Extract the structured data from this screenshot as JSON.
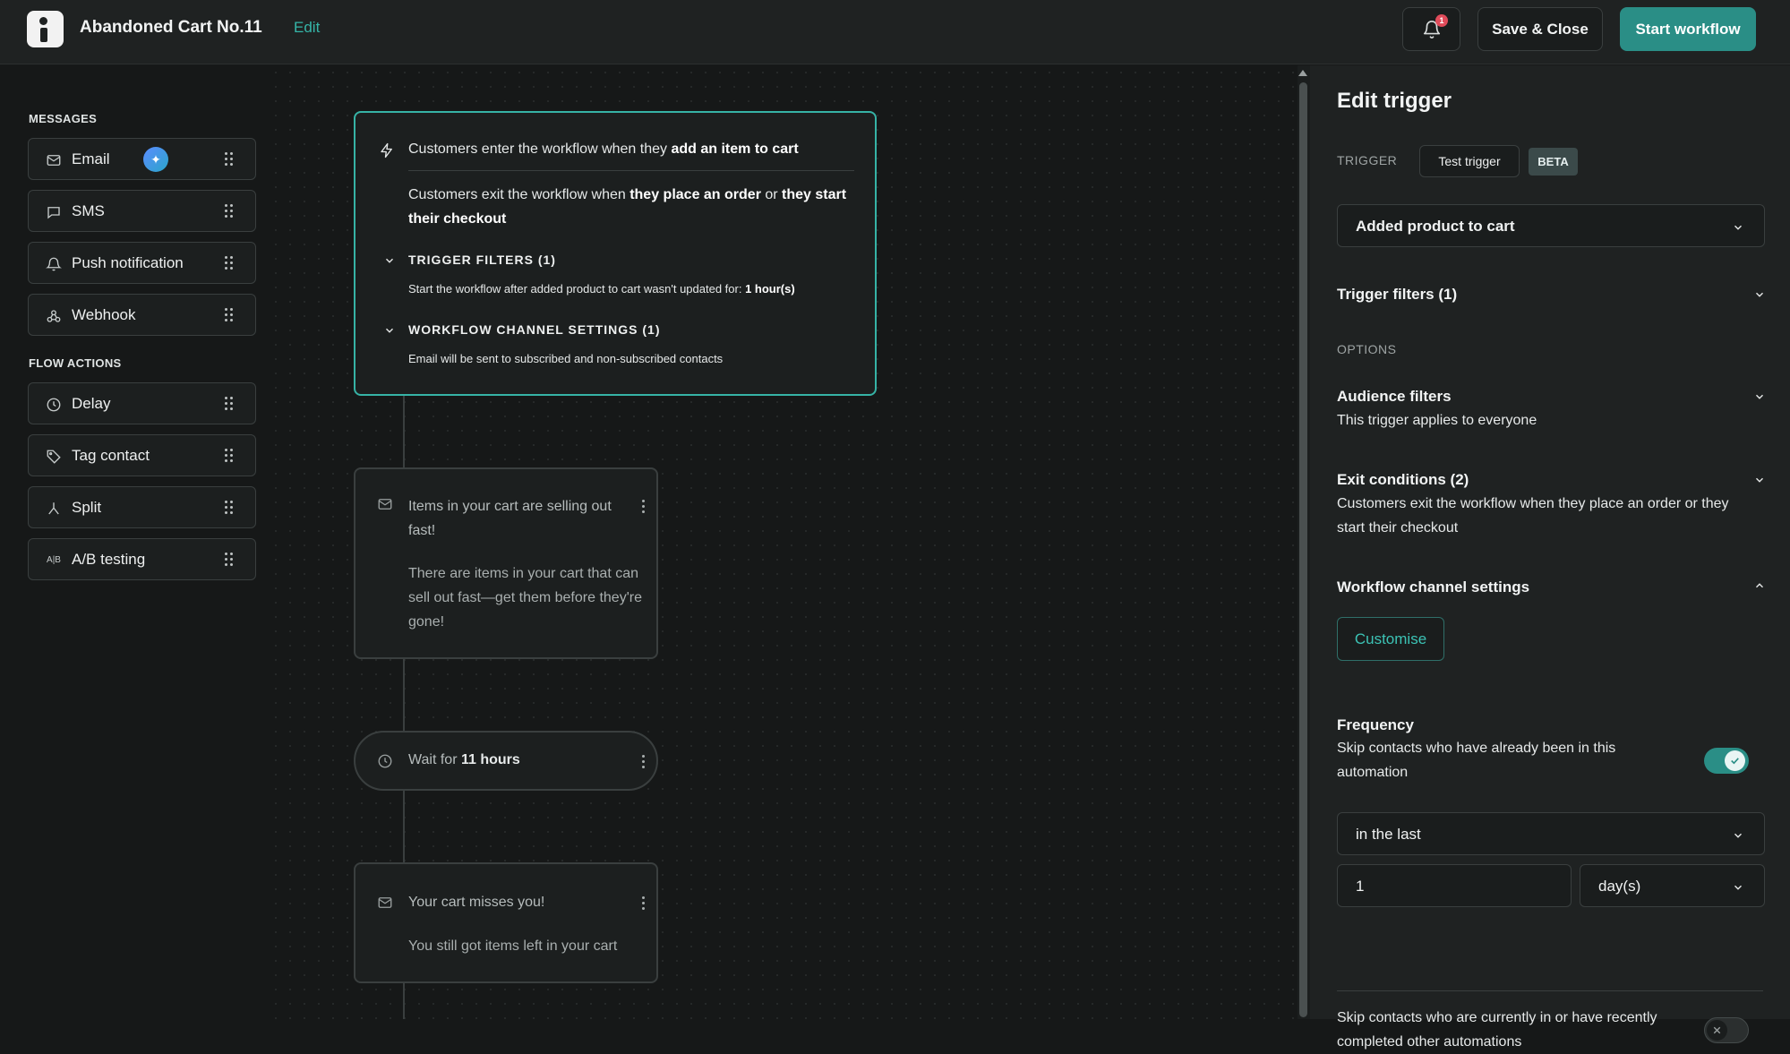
{
  "header": {
    "workflow_name": "Abandoned Cart No.11",
    "edit_label": "Edit",
    "notification_count": "1",
    "save_close_label": "Save & Close",
    "start_workflow_label": "Start workflow"
  },
  "sidebar": {
    "messages_heading": "MESSAGES",
    "messages": [
      {
        "label": "Email",
        "icon": "mail-icon"
      },
      {
        "label": "SMS",
        "icon": "chat-icon"
      },
      {
        "label": "Push notification",
        "icon": "bell-icon"
      },
      {
        "label": "Webhook",
        "icon": "webhook-icon"
      }
    ],
    "flow_actions_heading": "FLOW ACTIONS",
    "flow_actions": [
      {
        "label": "Delay",
        "icon": "clock-icon"
      },
      {
        "label": "Tag contact",
        "icon": "tag-icon"
      },
      {
        "label": "Split",
        "icon": "split-icon"
      },
      {
        "label": "A/B testing",
        "icon": "ab-icon",
        "icon_text": "A|B"
      }
    ]
  },
  "canvas": {
    "trigger": {
      "enter_prefix": "Customers enter the workflow when they ",
      "enter_bold": "add an item to cart",
      "exit_prefix": "Customers exit the workflow when ",
      "exit_bold1": "they place an order",
      "exit_mid": " or ",
      "exit_bold2": "they start their checkout",
      "filters_heading": "TRIGGER FILTERS (1)",
      "filters_text": "Start the workflow after added product to cart wasn't updated for: ",
      "filters_value": "1 hour(s)",
      "channel_heading": "WORKFLOW CHANNEL SETTINGS (1)",
      "channel_text": "Email will be sent to subscribed and non-subscribed contacts"
    },
    "email_node_1": {
      "title": "Items in your cart are selling out fast!",
      "body": "There are items in your cart that can sell out fast—get them before they're gone!"
    },
    "wait_node": {
      "prefix": "Wait for ",
      "value": "11 hours"
    },
    "email_node_2": {
      "title": "Your cart misses you!",
      "body": "You still got items left in your cart"
    }
  },
  "panel": {
    "title": "Edit trigger",
    "trigger_label": "TRIGGER",
    "test_trigger_label": "Test trigger",
    "beta_label": "BETA",
    "trigger_select_value": "Added product to cart",
    "trigger_filters_heading": "Trigger filters (1)",
    "options_label": "OPTIONS",
    "audience_heading": "Audience filters",
    "audience_text": "This trigger applies to everyone",
    "exit_heading": "Exit conditions (2)",
    "exit_text": "Customers exit the workflow when they place an order or they start their checkout",
    "channel_heading": "Workflow channel settings",
    "customise_label": "Customise",
    "frequency_heading": "Frequency",
    "frequency_text": "Skip contacts who have already been in this automation",
    "frequency_toggle_on": true,
    "period_select_value": "in the last",
    "period_amount_value": "1",
    "period_unit_value": "day(s)",
    "skip_other_text": "Skip contacts who are currently in or have recently completed other automations",
    "skip_other_toggle_on": false
  },
  "colors": {
    "accent": "#2a8e86",
    "accent_text": "#35b5a8",
    "badge": "#e04b5a",
    "background": "#161818",
    "panel": "#1f2222"
  }
}
